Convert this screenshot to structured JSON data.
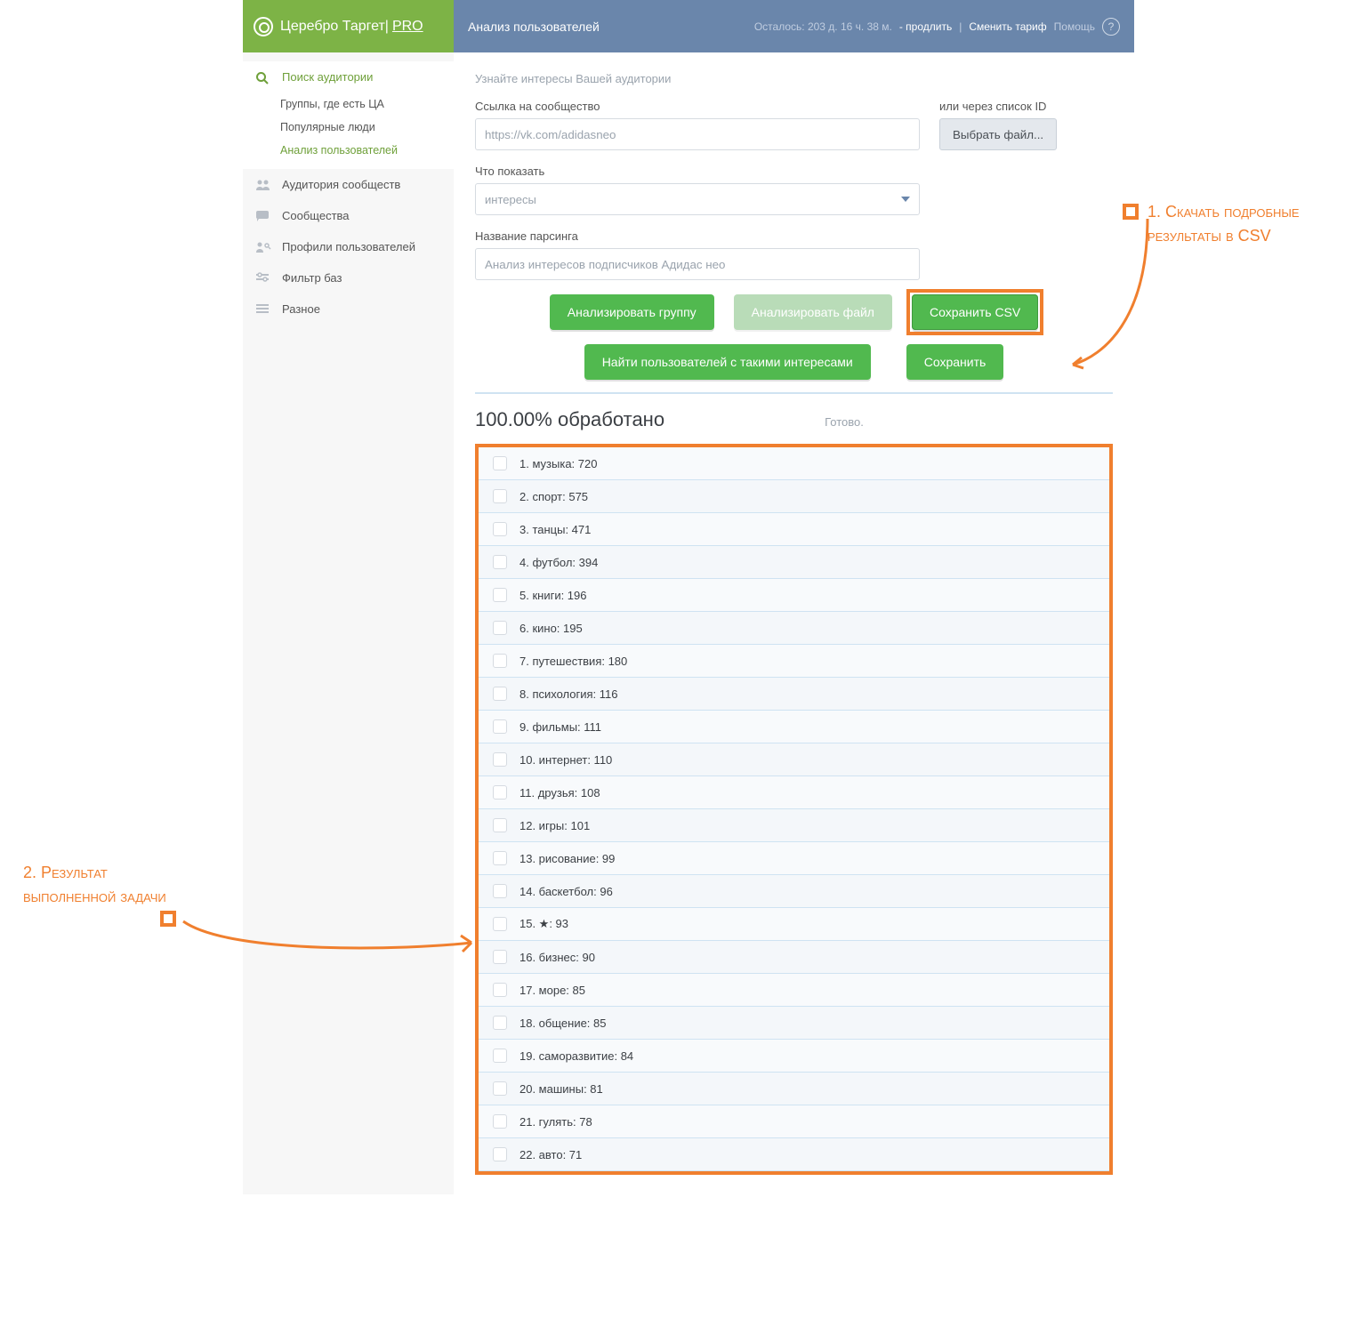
{
  "brand": {
    "name": "Церебро Таргет",
    "sep": " | ",
    "pro": "PRO"
  },
  "header": {
    "title": "Анализ пользователей",
    "remaining": "Осталось: 203 д. 16 ч. 38 м.",
    "extend": "- продлить",
    "change_tariff": "Сменить тариф",
    "help": "Помощь",
    "q": "?"
  },
  "sidebar": {
    "search": "Поиск аудитории",
    "sub1": "Группы, где есть ЦА",
    "sub2": "Популярные люди",
    "sub3": "Анализ пользователей",
    "aud": "Аудитория сообществ",
    "comm": "Сообщества",
    "profiles": "Профили пользователей",
    "filter": "Фильтр баз",
    "misc": "Разное"
  },
  "form": {
    "hint": "Узнайте интересы Вашей аудитории",
    "link_label": "Ссылка на сообщество",
    "link_value": "https://vk.com/adidasneo",
    "or_ids": "или через список ID",
    "choose_file": "Выбрать файл...",
    "show_label": "Что показать",
    "show_value": "интересы",
    "name_label": "Название парсинга",
    "name_value": "Анализ интересов подписчиков Адидас нео",
    "btn_analyze_group": "Анализировать группу",
    "btn_analyze_file": "Анализировать файл",
    "btn_save_csv": "Сохранить CSV",
    "btn_find_users": "Найти пользователей с такими интересами",
    "btn_save": "Сохранить"
  },
  "progress": {
    "text": "100.00% обработано",
    "done": "Готово."
  },
  "results": [
    {
      "n": 1,
      "label": "музыка",
      "count": 720
    },
    {
      "n": 2,
      "label": "спорт",
      "count": 575
    },
    {
      "n": 3,
      "label": "танцы",
      "count": 471
    },
    {
      "n": 4,
      "label": "футбол",
      "count": 394
    },
    {
      "n": 5,
      "label": "книги",
      "count": 196
    },
    {
      "n": 6,
      "label": "кино",
      "count": 195
    },
    {
      "n": 7,
      "label": "путешествия",
      "count": 180
    },
    {
      "n": 8,
      "label": "психология",
      "count": 116
    },
    {
      "n": 9,
      "label": "фильмы",
      "count": 111
    },
    {
      "n": 10,
      "label": "интернет",
      "count": 110
    },
    {
      "n": 11,
      "label": "друзья",
      "count": 108
    },
    {
      "n": 12,
      "label": "игры",
      "count": 101
    },
    {
      "n": 13,
      "label": "рисование",
      "count": 99
    },
    {
      "n": 14,
      "label": "баскетбол",
      "count": 96
    },
    {
      "n": 15,
      "label": "★",
      "count": 93
    },
    {
      "n": 16,
      "label": "бизнес",
      "count": 90
    },
    {
      "n": 17,
      "label": "море",
      "count": 85
    },
    {
      "n": 18,
      "label": "общение",
      "count": 85
    },
    {
      "n": 19,
      "label": "саморазвитие",
      "count": 84
    },
    {
      "n": 20,
      "label": "машины",
      "count": 81
    },
    {
      "n": 21,
      "label": "гулять",
      "count": 78
    },
    {
      "n": 22,
      "label": "авто",
      "count": 71
    }
  ],
  "annotations": {
    "a1": "1. Скачать подробные результаты в CSV",
    "a2": "2. Результат выполненной задачи"
  }
}
